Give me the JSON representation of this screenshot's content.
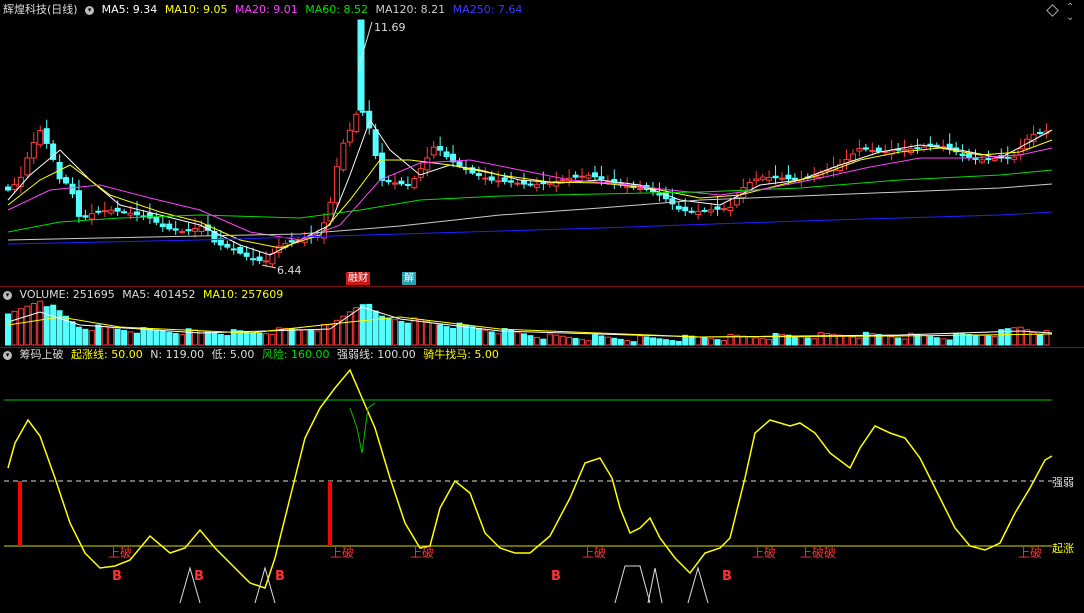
{
  "colors": {
    "up": "#ff3c3c",
    "down": "#54ffff",
    "ma5": "#ffffff",
    "ma10": "#ffff00",
    "ma20": "#ff40ff",
    "ma60": "#00e000",
    "ma120": "#cccccc",
    "ma250": "#2020ff",
    "osc": "#ffff00",
    "ref_line": "#00c000",
    "bar": "#ff0000",
    "label_red": "#ff3030"
  },
  "price": {
    "stock_name": "辉煌科技(日线)",
    "ma5_label": "MA5: 9.34",
    "ma10_label": "MA10: 9.05",
    "ma20_label": "MA20: 9.01",
    "ma60_label": "MA60: 8.52",
    "ma120_label": "MA120: 8.21",
    "ma250_label": "MA250: 7.64",
    "high_label": "11.69",
    "low_label": "6.44",
    "tag1": "融财",
    "tag2": "解",
    "diamond_icon": "diamond-icon"
  },
  "volume": {
    "vol_label": "VOLUME: 251695",
    "ma5_label": "MA5: 401452",
    "ma10_label": "MA10: 257609"
  },
  "indicator": {
    "name": "筹码上破",
    "p1": "起涨线: 50.00",
    "p2": "N: 119.00",
    "p3": "低: 5.00",
    "p4": "风险: 160.00",
    "p5": "强弱线: 100.00",
    "p6": "骑牛找马: 5.00",
    "right_label_1": "强弱",
    "right_label_2": "起涨",
    "marker_up": "上破",
    "marker_b": "B",
    "marker_combo": "上破破"
  },
  "chart_data": {
    "type": "candlestick",
    "high_value": 11.69,
    "low_value": 6.44,
    "ma_values": {
      "MA5": 9.34,
      "MA10": 9.05,
      "MA20": 9.01,
      "MA60": 8.52,
      "MA120": 8.21,
      "MA250": 7.64
    },
    "volume": 251695,
    "volume_ma5": 401452,
    "volume_ma10": 257609,
    "indicator_params": {
      "起涨线": 50,
      "N": 119,
      "低": 5,
      "风险": 160,
      "强弱线": 100,
      "骑牛找马": 5
    }
  }
}
